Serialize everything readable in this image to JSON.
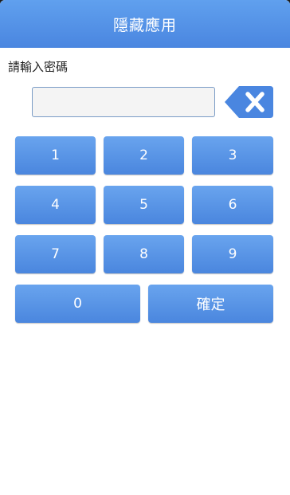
{
  "header": {
    "title": "隱藏應用"
  },
  "form": {
    "prompt": "請輸入密碼",
    "password_value": ""
  },
  "keypad": {
    "keys": [
      "1",
      "2",
      "3",
      "4",
      "5",
      "6",
      "7",
      "8",
      "9",
      "0"
    ],
    "confirm_label": "確定",
    "backspace_icon": "backspace-icon"
  },
  "colors": {
    "accent": "#4a86e0",
    "key_top": "#69a4ee",
    "key_bottom": "#4a86de",
    "input_border": "#7a9cc6"
  }
}
